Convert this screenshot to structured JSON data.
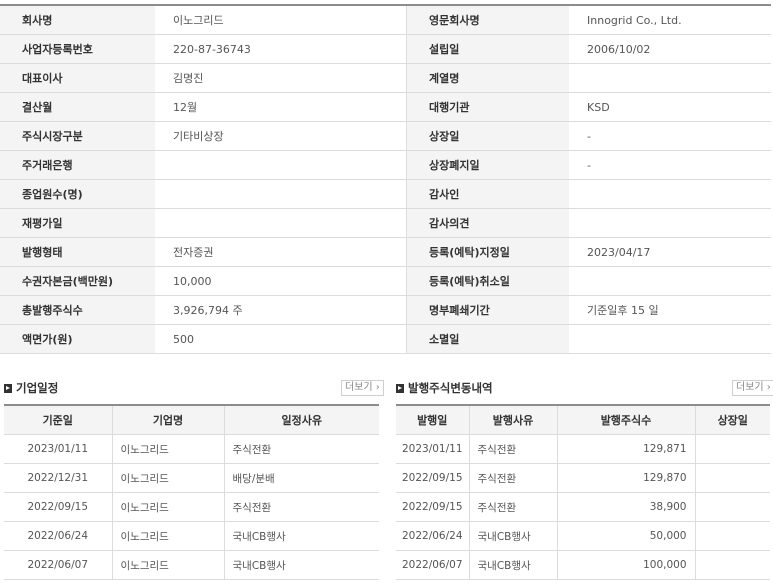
{
  "company_info": {
    "rows": [
      {
        "l1": "회사명",
        "v1": "이노그리드",
        "l2": "영문회사명",
        "v2": "Innogrid Co., Ltd."
      },
      {
        "l1": "사업자등록번호",
        "v1": "220-87-36743",
        "l2": "설립일",
        "v2": "2006/10/02"
      },
      {
        "l1": "대표이사",
        "v1": "김명진",
        "l2": "계열명",
        "v2": ""
      },
      {
        "l1": "결산월",
        "v1": "12월",
        "l2": "대행기관",
        "v2": "KSD"
      },
      {
        "l1": "주식시장구분",
        "v1": "기타비상장",
        "l2": "상장일",
        "v2": "-"
      },
      {
        "l1": "주거래은행",
        "v1": "",
        "l2": "상장폐지일",
        "v2": "-"
      },
      {
        "l1": "종업원수(명)",
        "v1": "",
        "l2": "감사인",
        "v2": ""
      },
      {
        "l1": "재평가일",
        "v1": "",
        "l2": "감사의견",
        "v2": ""
      },
      {
        "l1": "발행형태",
        "v1": "전자증권",
        "l2": "등록(예탁)지정일",
        "v2": "2023/04/17"
      },
      {
        "l1": "수권자본금(백만원)",
        "v1": "10,000",
        "l2": "등록(예탁)취소일",
        "v2": ""
      },
      {
        "l1": "총발행주식수",
        "v1": "3,926,794 주",
        "l2": "명부폐쇄기간",
        "v2": "기준일후 15 일"
      },
      {
        "l1": "액면가(원)",
        "v1": "500",
        "l2": "소멸일",
        "v2": ""
      }
    ]
  },
  "schedule": {
    "title": "기업일정",
    "more_label": "더보기",
    "headers": [
      "기준일",
      "기업명",
      "일정사유"
    ],
    "rows": [
      [
        "2023/01/11",
        "이노그리드",
        "주식전환"
      ],
      [
        "2022/12/31",
        "이노그리드",
        "배당/분배"
      ],
      [
        "2022/09/15",
        "이노그리드",
        "주식전환"
      ],
      [
        "2022/06/24",
        "이노그리드",
        "국내CB행사"
      ],
      [
        "2022/06/07",
        "이노그리드",
        "국내CB행사"
      ]
    ]
  },
  "share_changes": {
    "title": "발행주식변동내역",
    "more_label": "더보기",
    "headers": [
      "발행일",
      "발행사유",
      "발행주식수",
      "상장일"
    ],
    "rows": [
      [
        "2023/01/11",
        "주식전환",
        "129,871",
        ""
      ],
      [
        "2022/09/15",
        "주식전환",
        "129,870",
        ""
      ],
      [
        "2022/09/15",
        "주식전환",
        "38,900",
        ""
      ],
      [
        "2022/06/24",
        "국내CB행사",
        "50,000",
        ""
      ],
      [
        "2022/06/07",
        "국내CB행사",
        "100,000",
        ""
      ]
    ]
  }
}
